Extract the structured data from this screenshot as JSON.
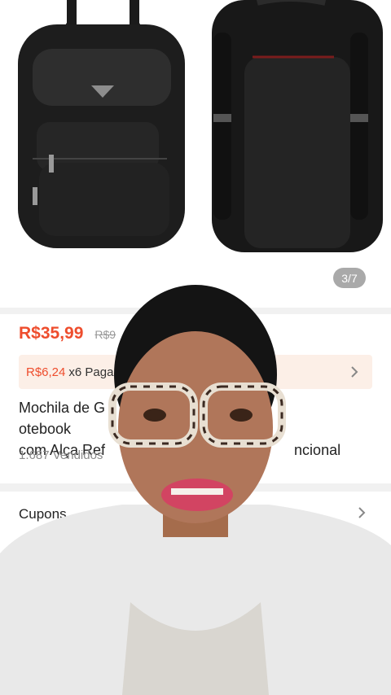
{
  "gallery": {
    "counter": "3/7"
  },
  "product": {
    "price": "R$35,99",
    "old_price": "R$9",
    "installment_price": "R$6,24",
    "installment_text": "x6 Paga",
    "title_line1": "Mochila de G",
    "title_line1_end": "otebook",
    "title_line2": "com Alça Ref",
    "title_line2_end": "ncional",
    "sold": "1.687 Vendidos"
  },
  "coupons": {
    "label": "Cupons"
  },
  "colors": {
    "accent": "#ee4d2d",
    "installment_bg": "#fcefe7"
  },
  "icons": [
    "chevron-right-icon"
  ]
}
